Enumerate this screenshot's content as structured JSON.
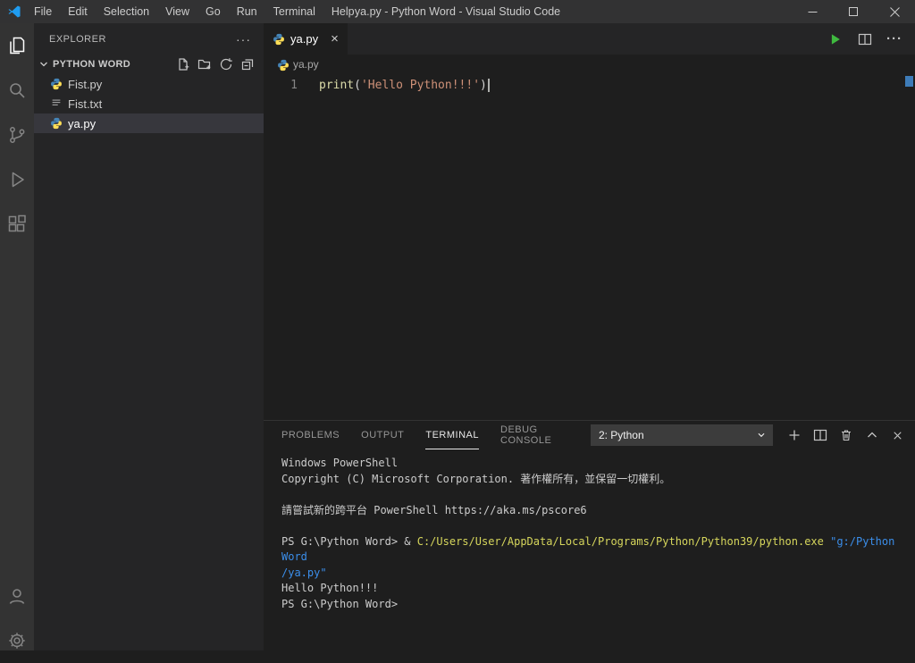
{
  "window": {
    "title": "ya.py - Python Word - Visual Studio Code",
    "menu_items": [
      "File",
      "Edit",
      "Selection",
      "View",
      "Go",
      "Run",
      "Terminal",
      "Help"
    ]
  },
  "sidebar": {
    "header": "EXPLORER",
    "header_menu": "···",
    "section": {
      "label": "PYTHON WORD"
    },
    "files": [
      {
        "name": "Fist.py",
        "icon": "python",
        "selected": false
      },
      {
        "name": "Fist.txt",
        "icon": "text",
        "selected": false
      },
      {
        "name": "ya.py",
        "icon": "python",
        "selected": true
      }
    ]
  },
  "editor": {
    "tab": {
      "label": "ya.py",
      "close": "×"
    },
    "breadcrumb": "ya.py",
    "more": "···",
    "line_number": "1",
    "code": {
      "fn": "print",
      "open": "(",
      "str": "'Hello Python!!!'",
      "close": ")"
    }
  },
  "panel": {
    "tabs": [
      {
        "label": "PROBLEMS",
        "active": false
      },
      {
        "label": "OUTPUT",
        "active": false
      },
      {
        "label": "TERMINAL",
        "active": true
      },
      {
        "label": "DEBUG CONSOLE",
        "active": false
      }
    ],
    "selector": {
      "value": "2: Python"
    },
    "terminal_lines": [
      [
        {
          "t": "Windows PowerShell",
          "c": "fg"
        }
      ],
      [
        {
          "t": "Copyright (C) Microsoft Corporation. 著作權所有，並保留一切權利。",
          "c": "fg"
        }
      ],
      [],
      [
        {
          "t": "請嘗試新的跨平台 PowerShell https://aka.ms/pscore6",
          "c": "fg"
        }
      ],
      [],
      [
        {
          "t": "PS G:\\Python Word> & ",
          "c": "fg"
        },
        {
          "t": "C:/Users/User/AppData/Local/Programs/Python/Python39/python.exe",
          "c": "cmd"
        },
        {
          "t": " ",
          "c": "fg"
        },
        {
          "t": "\"g:/Python Word",
          "c": "str"
        }
      ],
      [
        {
          "t": "/ya.py\"",
          "c": "str"
        }
      ],
      [
        {
          "t": "Hello Python!!!",
          "c": "fg"
        }
      ],
      [
        {
          "t": "PS G:\\Python Word>",
          "c": "fg"
        }
      ]
    ]
  },
  "colors": {
    "terminal_fg": "#cccccc",
    "terminal_cmd": "#d6d65c",
    "terminal_str": "#3b8eea",
    "code_fn": "#dcdcaa",
    "code_str": "#ce9178",
    "run_green": "#3fb93f",
    "overview_marker": "#3e7cb8",
    "selection_bg": "#37373d"
  }
}
